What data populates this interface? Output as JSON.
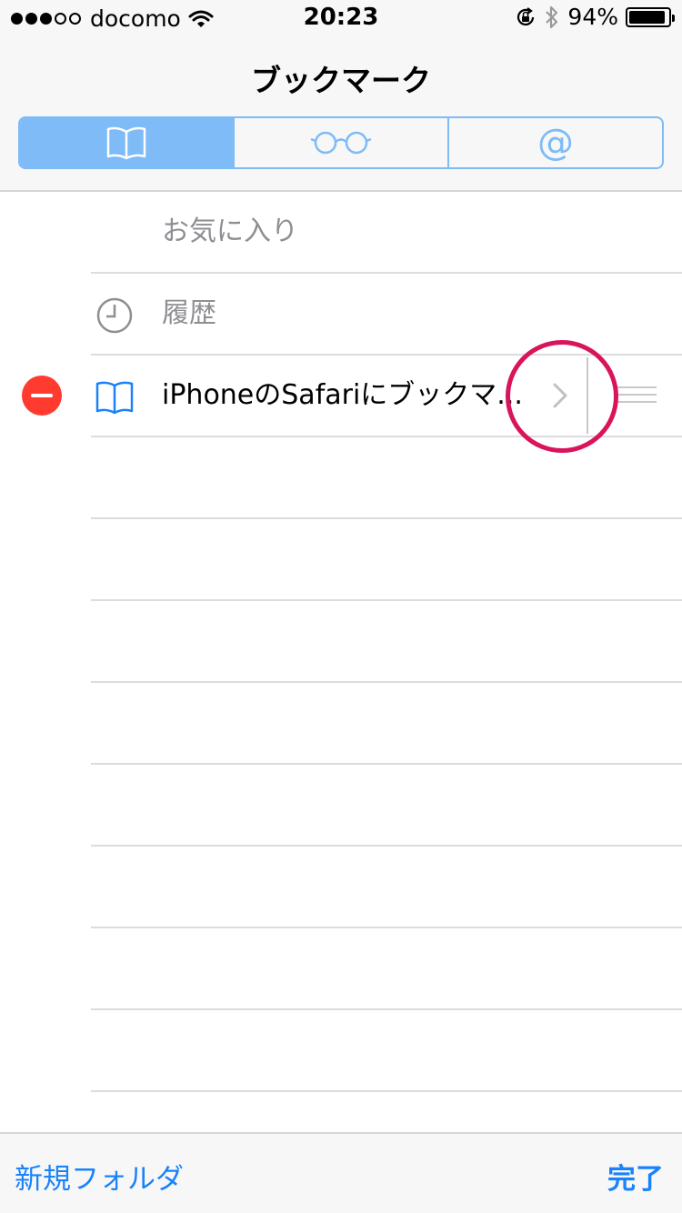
{
  "status_bar": {
    "carrier": "docomo",
    "time": "20:23",
    "battery": "94%",
    "battery_level": 0.94
  },
  "nav": {
    "title": "ブックマーク"
  },
  "segments": [
    {
      "icon": "book-icon",
      "active": true
    },
    {
      "icon": "glasses-icon",
      "active": false
    },
    {
      "icon": "at-sign-icon",
      "label": "@",
      "active": false
    }
  ],
  "list": {
    "favorites": {
      "label": "お気に入り"
    },
    "history": {
      "label": "履歴",
      "icon": "clock-icon"
    },
    "bookmark": {
      "label": "iPhoneのSafariにブックマ...",
      "icon": "book-icon"
    }
  },
  "toolbar": {
    "new_folder": "新規フォルダ",
    "done": "完了"
  },
  "colors": {
    "accent": "#1a82fb",
    "segment": "#7ebbf7",
    "delete": "#ff3b30",
    "highlight": "#d9145b"
  }
}
